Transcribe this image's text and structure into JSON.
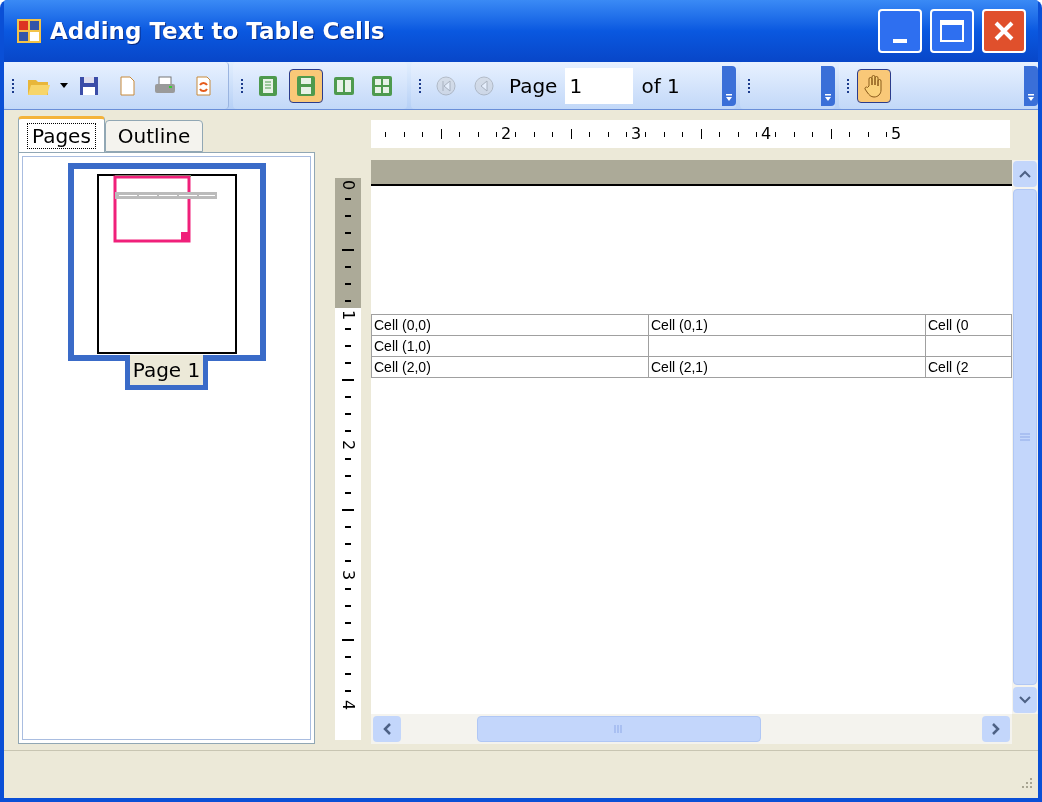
{
  "window": {
    "title": "Adding Text to Table Cells"
  },
  "toolbar": {
    "layout_buttons": [
      {
        "selected": false
      },
      {
        "selected": true
      },
      {
        "selected": false
      },
      {
        "selected": false
      }
    ],
    "navigation": {
      "first_disabled": true,
      "previous_disabled": true
    },
    "page_label": "Page",
    "page_value": "1",
    "page_total": "of 1",
    "hand_tool_selected": true
  },
  "tabs": [
    {
      "label": "Pages",
      "selected": true
    },
    {
      "label": "Outline",
      "selected": false
    }
  ],
  "thumbnails": [
    {
      "caption": "Page 1",
      "selected": true
    }
  ],
  "ruler": {
    "horizontal": [
      "2",
      "3",
      "4",
      "5"
    ],
    "vertical": [
      "0",
      "1",
      "2",
      "3",
      "4"
    ]
  },
  "table": {
    "rows": [
      [
        "Cell (0,0)",
        "Cell (0,1)",
        "Cell (0"
      ],
      [
        "Cell (1,0)",
        null,
        null
      ],
      [
        "Cell (2,0)",
        "Cell (2,1)",
        "Cell (2"
      ]
    ]
  }
}
